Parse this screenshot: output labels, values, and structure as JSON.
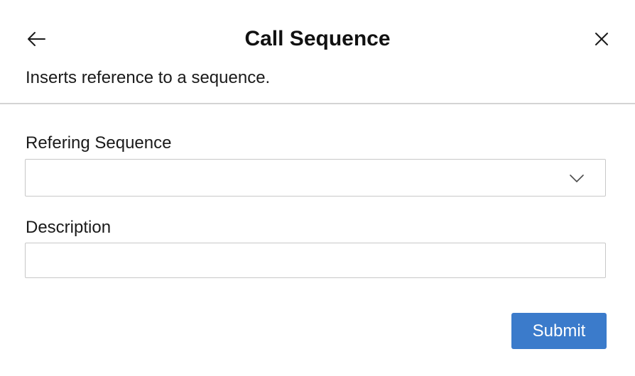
{
  "dialog": {
    "title": "Call Sequence",
    "subtitle": "Inserts reference to a sequence.",
    "back_icon": "arrow-left-icon",
    "close_icon": "close-icon"
  },
  "form": {
    "refering_sequence": {
      "label": "Refering Sequence",
      "value": "",
      "dropdown_icon": "chevron-down-icon"
    },
    "description": {
      "label": "Description",
      "value": "",
      "placeholder": ""
    }
  },
  "actions": {
    "submit_label": "Submit"
  },
  "colors": {
    "primary_button": "#3b7bcb",
    "divider": "#d4d4d4",
    "field_border": "#c8c8c8"
  }
}
